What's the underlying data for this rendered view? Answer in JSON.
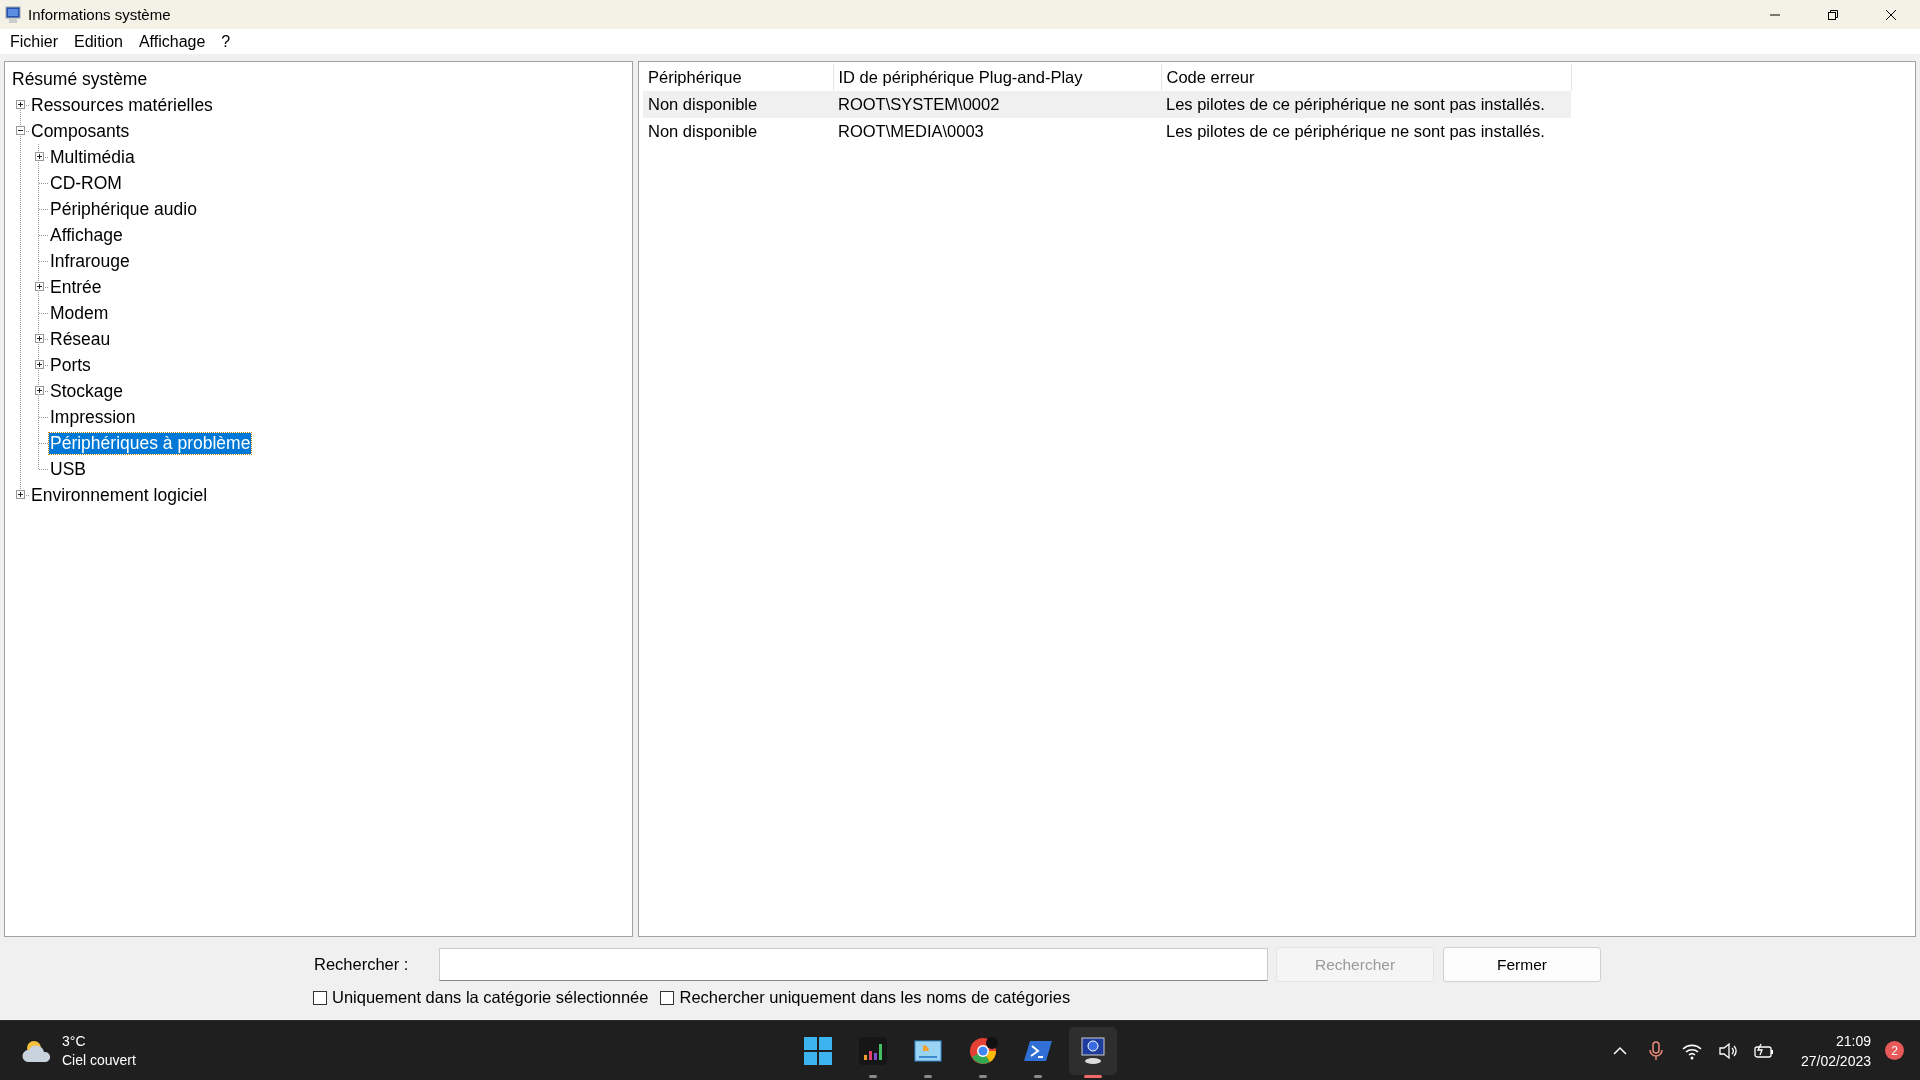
{
  "window": {
    "title": "Informations système"
  },
  "menu": [
    "Fichier",
    "Edition",
    "Affichage",
    "?"
  ],
  "tree": [
    {
      "label": "Résumé système",
      "kind": "summary",
      "selected": false
    },
    {
      "label": "Ressources matérielles",
      "kind": "branch",
      "expanded": false,
      "selected": false
    },
    {
      "label": "Composants",
      "kind": "branch",
      "expanded": true,
      "selected": false,
      "children": [
        {
          "label": "Multimédia",
          "kind": "branch",
          "expanded": false,
          "selected": false
        },
        {
          "label": "CD-ROM",
          "kind": "leaf",
          "selected": false
        },
        {
          "label": "Périphérique audio",
          "kind": "leaf",
          "selected": false
        },
        {
          "label": "Affichage",
          "kind": "leaf",
          "selected": false
        },
        {
          "label": "Infrarouge",
          "kind": "leaf",
          "selected": false
        },
        {
          "label": "Entrée",
          "kind": "branch",
          "expanded": false,
          "selected": false
        },
        {
          "label": "Modem",
          "kind": "leaf",
          "selected": false
        },
        {
          "label": "Réseau",
          "kind": "branch",
          "expanded": false,
          "selected": false
        },
        {
          "label": "Ports",
          "kind": "branch",
          "expanded": false,
          "selected": false
        },
        {
          "label": "Stockage",
          "kind": "branch",
          "expanded": false,
          "selected": false
        },
        {
          "label": "Impression",
          "kind": "leaf",
          "selected": false
        },
        {
          "label": "Périphériques à problème",
          "kind": "leaf",
          "selected": true
        },
        {
          "label": "USB",
          "kind": "leaf",
          "selected": false
        }
      ]
    },
    {
      "label": "Environnement logiciel",
      "kind": "branch",
      "expanded": false,
      "selected": false
    }
  ],
  "table": {
    "columns": [
      "Périphérique",
      "ID de périphérique Plug-and-Play",
      "Code erreur"
    ],
    "rows": [
      {
        "cells": [
          "Non disponible",
          "ROOT\\SYSTEM\\0002",
          "Les pilotes de ce périphérique ne sont pas installés."
        ],
        "selected": true
      },
      {
        "cells": [
          "Non disponible",
          "ROOT\\MEDIA\\0003",
          "Les pilotes de ce périphérique ne sont pas installés."
        ],
        "selected": false
      }
    ]
  },
  "search": {
    "label": "Rechercher :",
    "search_button": {
      "label": "Rechercher",
      "disabled": true
    },
    "close_button": {
      "label": "Fermer",
      "disabled": false
    },
    "options": [
      {
        "label": "Uniquement dans la catégorie sélectionnée",
        "checked": false
      },
      {
        "label": "Rechercher uniquement dans les noms de catégories",
        "checked": false
      }
    ]
  },
  "taskbar": {
    "weather": {
      "temperature": "3°C",
      "condition": "Ciel couvert"
    },
    "apps": [
      {
        "kind": "start",
        "running": false,
        "active": false
      },
      {
        "kind": "equalizer",
        "running": true,
        "active": false
      },
      {
        "kind": "diagram",
        "running": true,
        "active": false
      },
      {
        "kind": "browser",
        "running": true,
        "active": false
      },
      {
        "kind": "terminal",
        "running": true,
        "active": false
      },
      {
        "kind": "sysinfo",
        "running": true,
        "active": true
      }
    ],
    "time": "21:09",
    "date": "27/02/2023",
    "notifications": "2"
  }
}
